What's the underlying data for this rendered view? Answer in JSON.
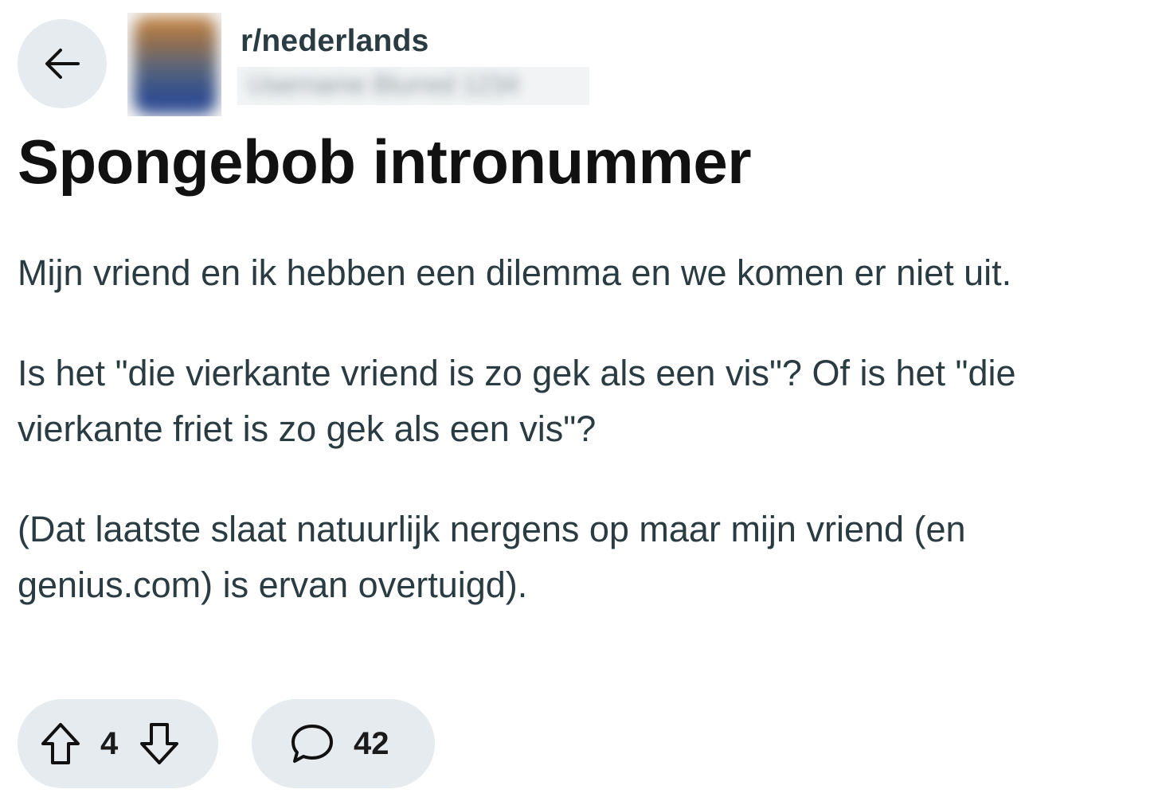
{
  "header": {
    "back_icon": "arrow-left-icon",
    "subreddit": "r/nederlands",
    "username_redacted": "Username Blurred 1234"
  },
  "post": {
    "title": "Spongebob intronummer",
    "body": [
      "Mijn vriend en ik hebben een dilemma en we komen er niet uit.",
      "Is het \"die vierkante vriend is zo gek als een vis\"? Of is het \"die",
      "vierkante friet is zo gek als een vis\"?",
      "(Dat laatste slaat natuurlijk nergens op maar mijn vriend (en",
      "genius.com) is ervan overtuigd)."
    ]
  },
  "actions": {
    "upvote_icon": "upvote-arrow-icon",
    "vote_count": "4",
    "downvote_icon": "downvote-arrow-icon",
    "comment_icon": "speech-bubble-icon",
    "comment_count": "42"
  },
  "colors": {
    "pill_background": "#e5ebee",
    "text_secondary": "#2a3c42",
    "text_primary": "#111111"
  }
}
